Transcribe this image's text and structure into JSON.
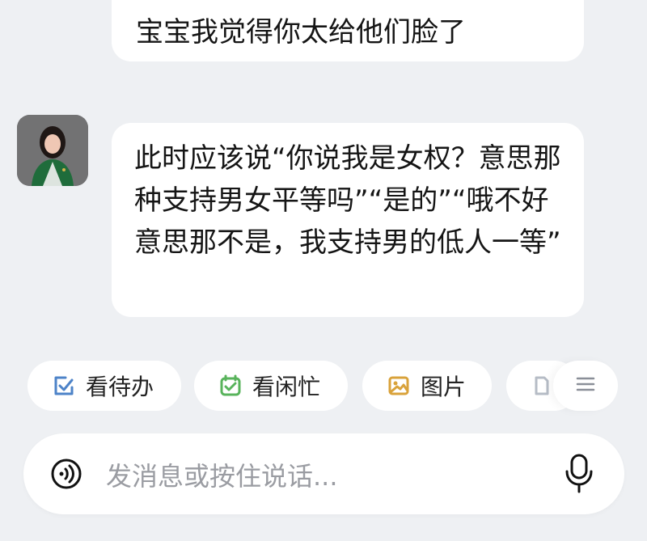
{
  "messages": [
    {
      "side": "right",
      "text": "宝宝我觉得你太给他们脸了"
    },
    {
      "side": "left",
      "text": "此时应该说“你说我是女权？意思那种支持男女平等吗”“是的”“哦不好意思那不是，我支持男的低人一等”"
    }
  ],
  "quick_actions": [
    {
      "label": "看待办",
      "icon": "checklist-icon",
      "color": "#4d83c8"
    },
    {
      "label": "看闲忙",
      "icon": "calendar-check-icon",
      "color": "#58b35b"
    },
    {
      "label": "图片",
      "icon": "image-icon",
      "color": "#d9a23a"
    },
    {
      "label": "",
      "icon": "document-icon",
      "color": "#b6bcc6"
    }
  ],
  "menu": {
    "icon": "menu-icon"
  },
  "composer": {
    "placeholder": "发消息或按住说话...",
    "left_icon": "voice-toggle-icon",
    "right_icon": "microphone-icon"
  }
}
